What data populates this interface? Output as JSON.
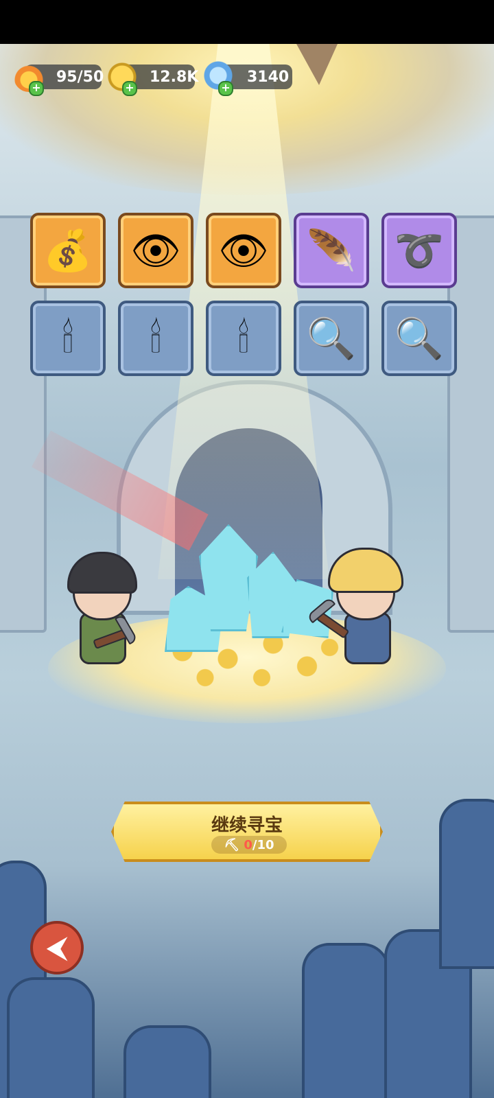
{
  "hud": {
    "energy": {
      "value": "95/50",
      "icon": "flame-icon"
    },
    "gold": {
      "value": "12.8K",
      "icon": "gold-coin-icon"
    },
    "gems": {
      "value": "3140",
      "icon": "crystal-icon"
    }
  },
  "items": [
    {
      "icon": "treasure-chest-icon",
      "glyph": "💰",
      "rarity": "orange"
    },
    {
      "icon": "eye-tome-icon",
      "glyph": "👁",
      "rarity": "orange"
    },
    {
      "icon": "eye-tome-icon",
      "glyph": "👁",
      "rarity": "orange"
    },
    {
      "icon": "feather-icon",
      "glyph": "🪶",
      "rarity": "purple"
    },
    {
      "icon": "vine-ring-icon",
      "glyph": "➰",
      "rarity": "purple"
    },
    {
      "icon": "candle-icon",
      "glyph": "🕯",
      "rarity": "blue"
    },
    {
      "icon": "candle-icon",
      "glyph": "🕯",
      "rarity": "blue"
    },
    {
      "icon": "candle-icon",
      "glyph": "🕯",
      "rarity": "blue"
    },
    {
      "icon": "pocket-mirror-icon",
      "glyph": "🔍",
      "rarity": "blue"
    },
    {
      "icon": "pocket-mirror-icon",
      "glyph": "🔍",
      "rarity": "blue"
    }
  ],
  "continue_button": {
    "label": "继续寻宝",
    "cost_current": "0",
    "cost_total": "/10",
    "cost_icon": "pickaxe-icon"
  },
  "back_button": {
    "icon": "back-arrow-icon",
    "glyph": "⮜"
  },
  "colors": {
    "orange": "#f3a640",
    "purple": "#b08be8",
    "blue": "#7f9ec5",
    "button": "#f6d24c"
  }
}
